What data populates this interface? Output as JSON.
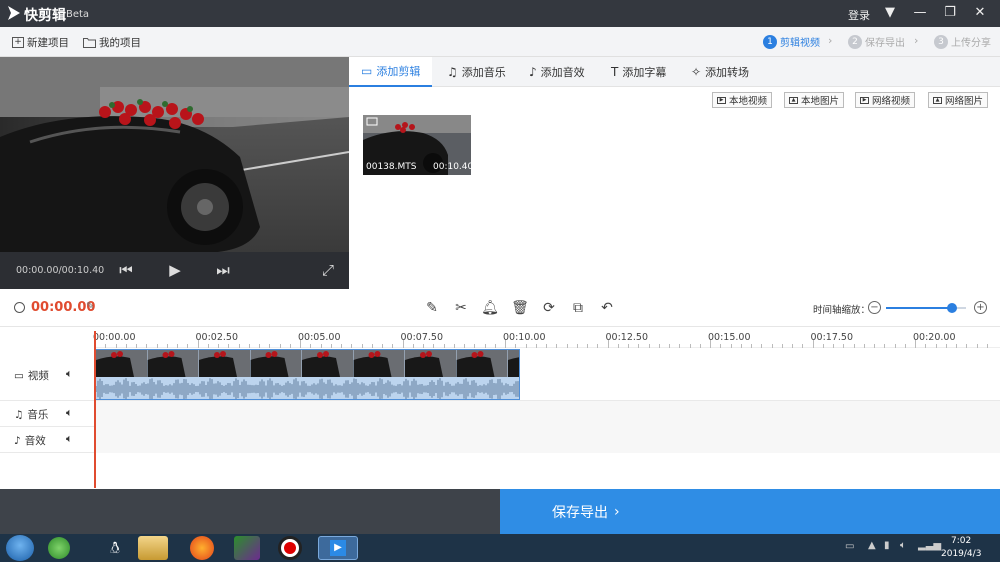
{
  "titlebar": {
    "title": "快剪辑",
    "badge": "Beta",
    "login": "登录"
  },
  "toolbar": {
    "new_project": "新建项目",
    "my_projects": "我的项目",
    "steps": [
      {
        "num": "1",
        "label": "剪辑视频",
        "active": true
      },
      {
        "num": "2",
        "label": "保存导出",
        "active": false
      },
      {
        "num": "3",
        "label": "上传分享",
        "active": false
      }
    ]
  },
  "preview": {
    "time": "00:00.00/00:10.40"
  },
  "tabs": [
    {
      "label": "添加剪辑",
      "icon": "video-icon",
      "active": true
    },
    {
      "label": "添加音乐",
      "icon": "music-icon",
      "active": false
    },
    {
      "label": "添加音效",
      "icon": "sound-effect-icon",
      "active": false
    },
    {
      "label": "添加字幕",
      "icon": "text-icon",
      "active": false
    },
    {
      "label": "添加转场",
      "icon": "transition-icon",
      "active": false
    }
  ],
  "source_buttons": [
    "本地视频",
    "本地图片",
    "网络视频",
    "网络图片"
  ],
  "clip": {
    "name": "00138.MTS",
    "duration": "00:10.40"
  },
  "editor": {
    "current_time": "00:00.00",
    "zoom_label": "时间轴缩放：",
    "zoom_level": 0.82
  },
  "ruler": [
    "00:00.00",
    "00:02.50",
    "00:05.00",
    "00:07.50",
    "00:10.00",
    "00:12.50",
    "00:15.00",
    "00:17.50",
    "00:20.00"
  ],
  "tracks": [
    {
      "label": "视频",
      "icon": "video-icon"
    },
    {
      "label": "音乐",
      "icon": "music-icon"
    },
    {
      "label": "音效",
      "icon": "sound-effect-icon"
    }
  ],
  "export": {
    "label": "保存导出"
  },
  "taskbar": {
    "time": "7:02",
    "date": "2019/4/3"
  },
  "colors": {
    "accent": "#2b7fe0",
    "time_red": "#e04b2f",
    "titlebar": "#34383f"
  }
}
